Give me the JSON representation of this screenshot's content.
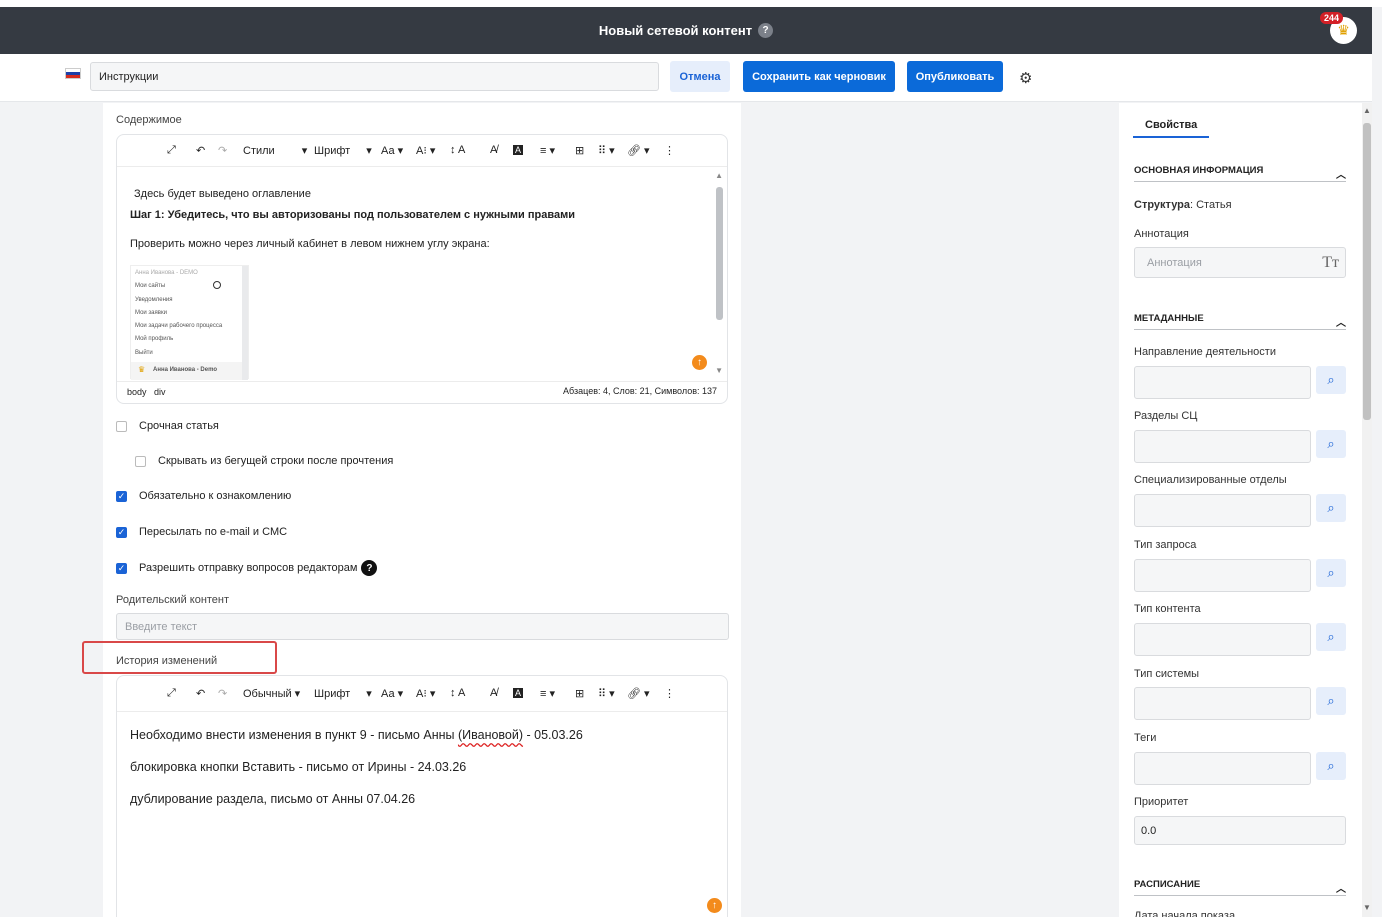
{
  "header": {
    "title": "Новый сетевой контент",
    "help": "?",
    "notifications": "244"
  },
  "actions": {
    "title_value": "Инструкции",
    "cancel": "Отмена",
    "save_draft": "Сохранить как черновик",
    "publish": "Опубликовать"
  },
  "content": {
    "label": "Содержимое",
    "toolbar": {
      "styles": "Стили",
      "font": "Шрифт",
      "size": "Аа",
      "caps": "A",
      "line": "A"
    },
    "toc": "Здесь будет выведено оглавление",
    "step1": "Шаг 1: Убедитесь, что вы авторизованы под пользователем с нужными правами",
    "check_text": "Проверить можно через личный кабинет в левом нижнем углу экрана:",
    "embed": {
      "header": "Анна Иванова - DEMO",
      "items": [
        "Мои сайты",
        "Уведомления",
        "Мои заявки",
        "Мои задачи рабочего процесса",
        "Мой профиль",
        "Выйти"
      ],
      "user": "Анна Иванова - Demo"
    },
    "path1": "body",
    "path2": "div",
    "stats": "Абзацев: 4, Слов: 21, Символов: 137"
  },
  "checkboxes": {
    "urgent": "Срочная статья",
    "hide": "Скрывать из бегущей строки после прочтения",
    "mandatory": "Обязательно к ознакомлению",
    "forward": "Пересылать по e-mail и СМС",
    "allow": "Разрешить отправку вопросов редакторам"
  },
  "parent": {
    "label": "Родительский контент",
    "placeholder": "Введите текст"
  },
  "history": {
    "label": "История изменений",
    "toolbar": {
      "styles": "Обычный",
      "font": "Шрифт",
      "size": "Аа"
    },
    "line1_a": "Необходимо внести изменения в пункт 9 - письмо Анны ",
    "line1_b": "(Ивановой)",
    "line1_c": " -  05.03.26",
    "line2": "блокировка кнопки Вставить - письмо от Ирины -  24.03.26",
    "line3": "дублирование раздела, письмо  от Анны 07.04.26"
  },
  "properties": {
    "tab": "Свойства",
    "basic_header": "ОСНОВНАЯ ИНФОРМАЦИЯ",
    "structure_label": "Структура",
    "structure_value": ": Статья",
    "annotation_label": "Аннотация",
    "annotation_placeholder": "Аннотация",
    "meta_header": "МЕТАДАННЫЕ",
    "fields": [
      "Направление деятельности",
      "Разделы СЦ",
      "Специализированные отделы",
      "Тип запроса",
      "Тип контента",
      "Тип системы",
      "Теги"
    ],
    "priority_label": "Приоритет",
    "priority_value": "0.0",
    "schedule_header": "РАСПИСАНИЕ",
    "schedule_cut": "Дата начала показа"
  }
}
